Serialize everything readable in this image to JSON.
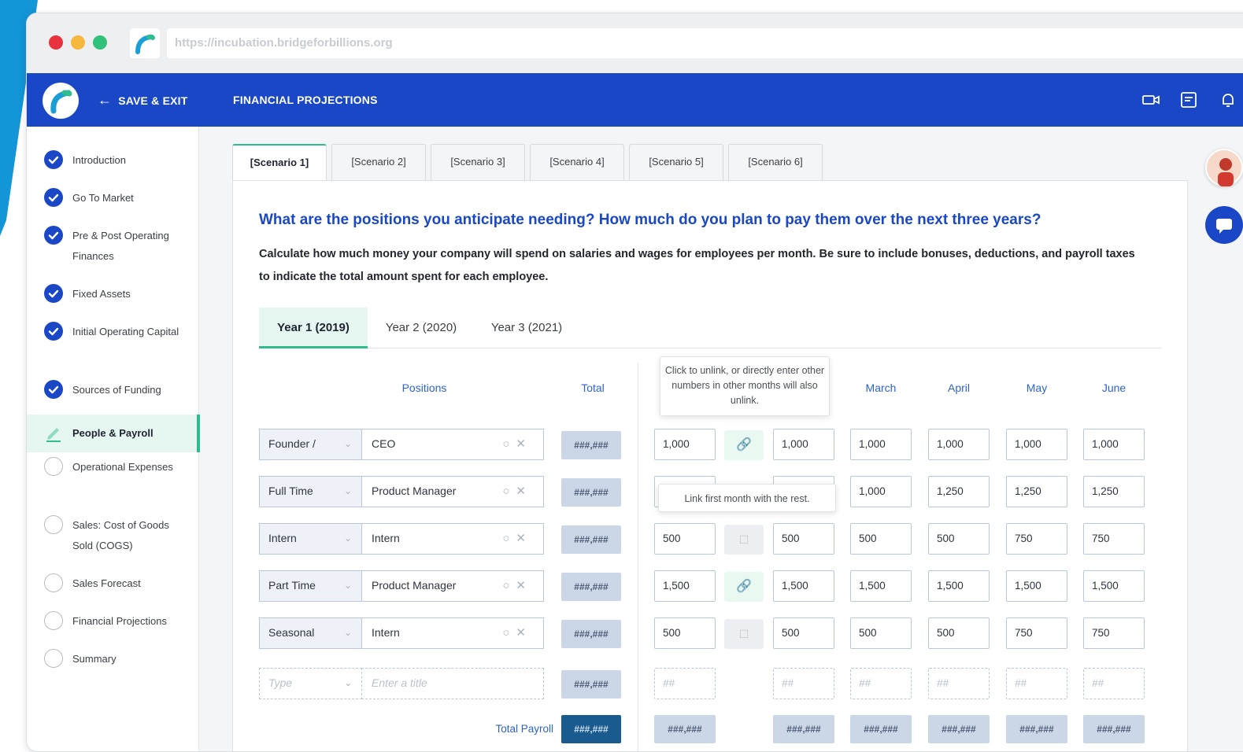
{
  "browser": {
    "url": "https://incubation.bridgeforbillions.org"
  },
  "appbar": {
    "save_exit": "SAVE & EXIT",
    "title": "FINANCIAL PROJECTIONS"
  },
  "sidebar": {
    "items": [
      {
        "label": "Introduction",
        "status": "done"
      },
      {
        "label": "Go To Market",
        "status": "done"
      },
      {
        "label": "Pre & Post Operating Finances",
        "status": "done"
      },
      {
        "label": "Fixed Assets",
        "status": "done"
      },
      {
        "label": "Initial Operating Capital",
        "status": "done"
      },
      {
        "label": "Sources of Funding",
        "status": "done"
      },
      {
        "label": "People & Payroll",
        "status": "active"
      },
      {
        "label": "Operational Expenses",
        "status": "todo"
      },
      {
        "label": "Sales: Cost of Goods Sold (COGS)",
        "status": "todo"
      },
      {
        "label": "Sales Forecast",
        "status": "todo"
      },
      {
        "label": "Financial Projections",
        "status": "todo"
      },
      {
        "label": "Summary",
        "status": "todo"
      }
    ]
  },
  "scenarios": [
    "[Scenario 1]",
    "[Scenario 2]",
    "[Scenario 3]",
    "[Scenario 4]",
    "[Scenario 5]",
    "[Scenario 6]"
  ],
  "question": "What are the positions you anticipate needing? How much do you plan to pay them over the next three years?",
  "description": "Calculate how much money your company will spend on salaries and wages for employees per month. Be sure to include bonuses, deductions, and payroll taxes to indicate the total amount spent for each employee.",
  "year_tabs": [
    "Year 1 (2019)",
    "Year 2 (2020)",
    "Year 3 (2021)"
  ],
  "columns": {
    "positions": "Positions",
    "total": "Total",
    "march": "March",
    "april": "April",
    "may": "May",
    "june": "June"
  },
  "tooltips": {
    "unlink": "Click to unlink, or directly enter other numbers in other months will also unlink.",
    "link": "Link first month with the rest."
  },
  "rows": [
    {
      "type": "Founder /",
      "title": "CEO",
      "total": "###,###",
      "m1": "1,000",
      "m2": "1,000",
      "m3": "1,000",
      "m4": "1,000",
      "m5": "1,000",
      "m6": "1,000",
      "linked": true
    },
    {
      "type": "Full Time",
      "title": "Product Manager",
      "total": "###,###",
      "m1": "",
      "m2": "",
      "m3": "1,000",
      "m4": "1,250",
      "m5": "1,250",
      "m6": "1,250",
      "linked": false
    },
    {
      "type": "Intern",
      "title": "Intern",
      "total": "###,###",
      "m1": "500",
      "m2": "500",
      "m3": "500",
      "m4": "500",
      "m5": "750",
      "m6": "750",
      "linked": false
    },
    {
      "type": "Part Time",
      "title": "Product Manager",
      "total": "###,###",
      "m1": "1,500",
      "m2": "1,500",
      "m3": "1,500",
      "m4": "1,500",
      "m5": "1,500",
      "m6": "1,500",
      "linked": true
    },
    {
      "type": "Seasonal",
      "title": "Intern",
      "total": "###,###",
      "m1": "500",
      "m2": "500",
      "m3": "500",
      "m4": "500",
      "m5": "750",
      "m6": "750",
      "linked": false
    }
  ],
  "new_row": {
    "type_placeholder": "Type",
    "title_placeholder": "Enter a title",
    "total": "###,###",
    "month_placeholder": "##"
  },
  "totals": {
    "label": "Total Payroll",
    "total": "###,###",
    "m1": "###,###",
    "m2": "###,###",
    "m3": "###,###",
    "m4": "###,###",
    "m5": "###,###",
    "m6": "###,###"
  },
  "colors": {
    "brand_blue": "#1a47c6",
    "accent_green": "#2fbd90",
    "chrome_red": "#e8333f",
    "chrome_yellow": "#f5b83d",
    "chrome_green": "#31c17a"
  }
}
